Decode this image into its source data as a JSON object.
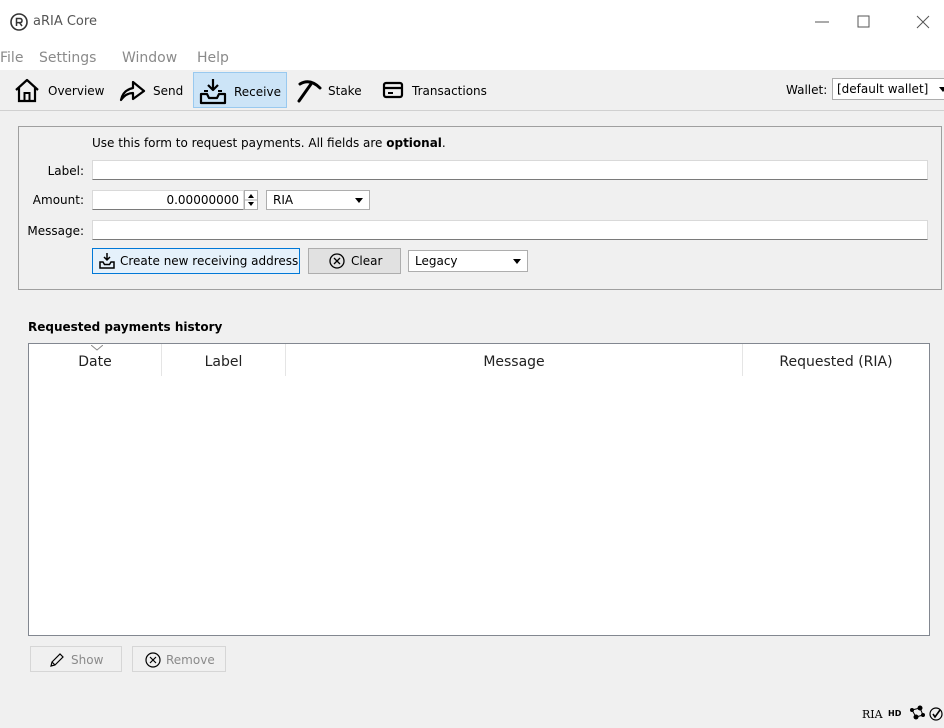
{
  "window": {
    "title": "aRIA Core"
  },
  "menu": [
    "File",
    "Settings",
    "Window",
    "Help"
  ],
  "toolbar": {
    "overview": "Overview",
    "send": "Send",
    "receive": "Receive",
    "stake": "Stake",
    "transactions": "Transactions",
    "wallet_label": "Wallet:",
    "wallet_value": "[default wallet]"
  },
  "form": {
    "intro_prefix": "Use this form to request payments. All fields are ",
    "intro_bold": "optional",
    "intro_suffix": ".",
    "label_label": "Label:",
    "amount_label": "Amount:",
    "message_label": "Message:",
    "amount_value": "0.00000000",
    "unit": "RIA",
    "create_button": "Create new receiving address",
    "clear_button": "Clear",
    "address_type": "Legacy"
  },
  "history": {
    "title": "Requested payments history",
    "columns": [
      "Date",
      "Label",
      "Message",
      "Requested (RIA)"
    ],
    "rows": []
  },
  "actions": {
    "show": "Show",
    "remove": "Remove"
  },
  "status": {
    "unit": "RIA",
    "hd": "HD"
  },
  "colors": {
    "active_tab": "#cce4f7",
    "focus_border": "#0078d7"
  }
}
